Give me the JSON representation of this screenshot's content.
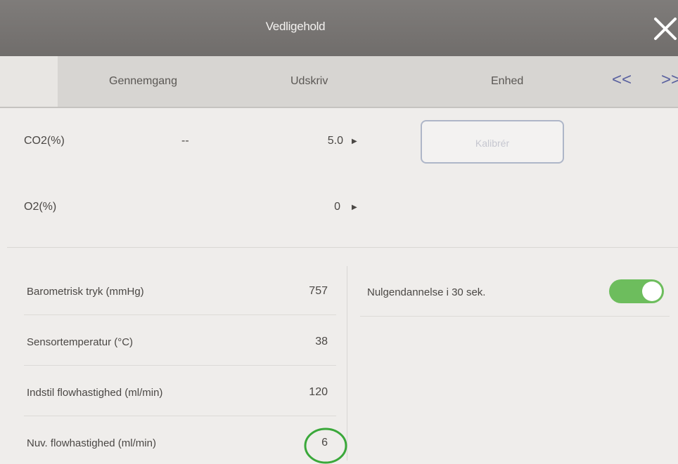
{
  "window": {
    "title": "Vedligehold",
    "close_icon": "close-icon"
  },
  "tabs": {
    "items": [
      {
        "label": "Gennemgang"
      },
      {
        "label": "Udskriv"
      },
      {
        "label": "Enhed"
      }
    ],
    "nav_prev": "<<",
    "nav_next": ">>"
  },
  "gas": {
    "co2": {
      "label": "CO2(%)",
      "measured": "--",
      "setpoint": "5.0",
      "arrow": "▶"
    },
    "o2": {
      "label": "O2(%)",
      "setpoint": "0",
      "arrow": "▶"
    },
    "calibrate_label": "Kalibrér"
  },
  "params": [
    {
      "label": "Barometrisk tryk (mmHg)",
      "value": "757"
    },
    {
      "label": "Sensortemperatur (°C)",
      "value": "38"
    },
    {
      "label": "Indstil flowhastighed (ml/min)",
      "value": "120"
    },
    {
      "label": "Nuv. flowhastighed (ml/min)",
      "value": "6"
    }
  ],
  "auto_zero": {
    "label": "Nulgendannelse i 30 sek.",
    "enabled": true
  },
  "colors": {
    "toggle_on": "#6dbd5d",
    "annotation_circle": "#3aa83a",
    "nav_accent": "#5b62a0"
  }
}
